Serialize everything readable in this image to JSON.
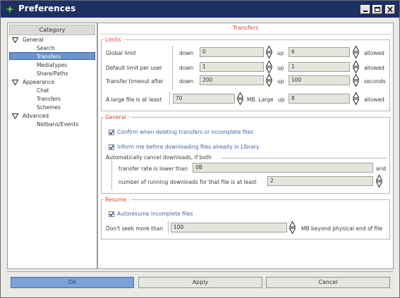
{
  "window": {
    "title": "Preferences"
  },
  "sidebar": {
    "header": "Category",
    "items": [
      {
        "label": "General",
        "level": 0,
        "expanded": true
      },
      {
        "label": "Search",
        "level": 1
      },
      {
        "label": "Transfers",
        "level": 1,
        "selected": true
      },
      {
        "label": "Mediatypes",
        "level": 1
      },
      {
        "label": "Share/Paths",
        "level": 1
      },
      {
        "label": "Appearance",
        "level": 0,
        "expanded": true
      },
      {
        "label": "Chat",
        "level": 1
      },
      {
        "label": "Transfers",
        "level": 1
      },
      {
        "label": "Schemes",
        "level": 1
      },
      {
        "label": "Advanced",
        "level": 0,
        "expanded": true
      },
      {
        "label": "Netbans/Events",
        "level": 1
      }
    ]
  },
  "main": {
    "title": "Transfers",
    "limits": {
      "title": "Limits :",
      "global_label": "Global limit",
      "default_label": "Default limit per user",
      "timeout_label": "Transfer timeout after",
      "down_label": "down",
      "up_label": "up",
      "allowed_label": "allowed",
      "seconds_label": "seconds",
      "global_down": "0",
      "global_up": "6",
      "default_down": "1",
      "default_up": "1",
      "timeout_down": "200",
      "timeout_up": "100",
      "large_label": "A large file is at least",
      "large_value": "70",
      "mb_large_label": "MB. Large",
      "large_up": "8"
    },
    "general": {
      "title": "General :",
      "confirm_label": "Confirm when deleting transfers or incomplete files",
      "confirm_checked": true,
      "inform_label": "Inform me before downloading files already in Library",
      "inform_checked": true,
      "auto_cancel_label": "Automatically cancel downloads, if both",
      "rate_label": "transfer rate is lower than",
      "rate_value": "0B",
      "and_label": "and",
      "running_label": "number of running downloads for that file is at least",
      "running_value": "2"
    },
    "resume": {
      "title": "Resume :",
      "autoresume_label": "Autoresume incomplete files",
      "autoresume_checked": true,
      "seek_label": "Don't seek more than",
      "seek_value": "100",
      "seek_suffix": "MB beyond physical end of file"
    }
  },
  "buttons": {
    "ok": "Ok",
    "apply": "Apply",
    "cancel": "Cancel"
  }
}
